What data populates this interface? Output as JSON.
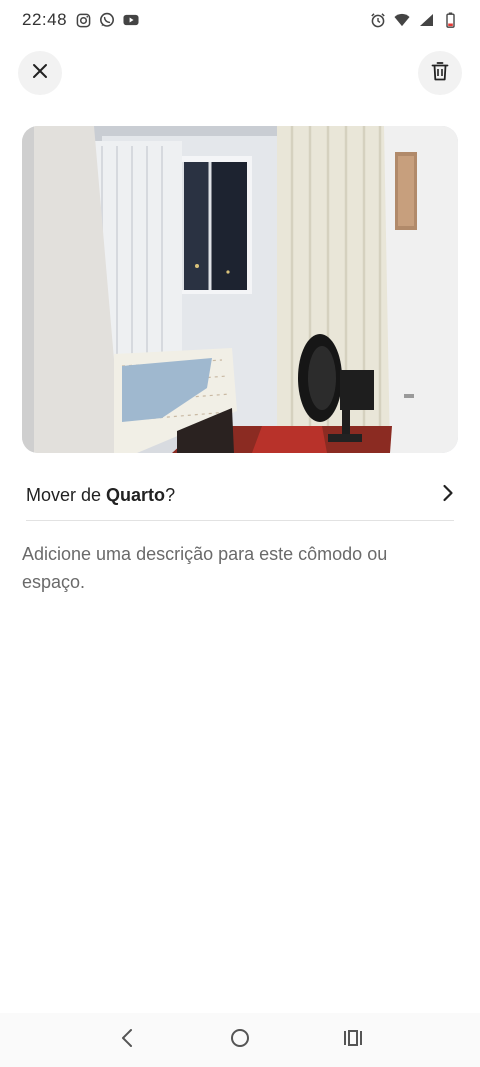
{
  "status_bar": {
    "time": "22:48",
    "left_icons": [
      "instagram-icon",
      "whatsapp-icon",
      "youtube-icon"
    ],
    "right_icons": [
      "alarm-icon",
      "wifi-icon",
      "signal-icon",
      "battery-icon"
    ]
  },
  "header": {
    "close_icon": "close-icon",
    "delete_icon": "trash-icon"
  },
  "photo": {
    "subject": "room-photo"
  },
  "move_row": {
    "prefix": "Mover de ",
    "room": "Quarto",
    "suffix": "?",
    "chevron_icon": "chevron-right-icon"
  },
  "description_placeholder": "Adicione uma descrição para este cômodo ou espaço.",
  "nav_bar": {
    "back_icon": "back-icon",
    "home_icon": "home-icon",
    "recents_icon": "recents-icon"
  },
  "colors": {
    "text_primary": "#222222",
    "text_secondary": "#6a6a6a",
    "button_bg": "#f2f2f2",
    "divider": "#e2e2e2"
  }
}
